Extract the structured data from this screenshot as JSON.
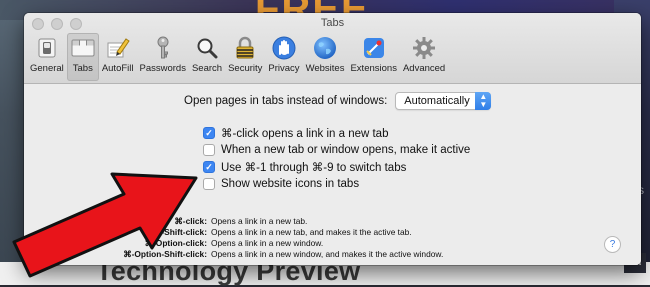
{
  "background": {
    "headline": "Technology Preview",
    "promo": "FREE",
    "corner_badge": "DII",
    "side_text": "ES"
  },
  "window": {
    "title": "Tabs"
  },
  "toolbar": {
    "items": [
      {
        "label": "General",
        "icon": "switch-icon"
      },
      {
        "label": "Tabs",
        "icon": "tabs-icon",
        "active": true
      },
      {
        "label": "AutoFill",
        "icon": "pencil-icon"
      },
      {
        "label": "Passwords",
        "icon": "key-icon"
      },
      {
        "label": "Search",
        "icon": "magnifier-icon"
      },
      {
        "label": "Security",
        "icon": "lock-icon"
      },
      {
        "label": "Privacy",
        "icon": "hand-icon"
      },
      {
        "label": "Websites",
        "icon": "globe-icon"
      },
      {
        "label": "Extensions",
        "icon": "puzzle-icon"
      },
      {
        "label": "Advanced",
        "icon": "gear-icon"
      }
    ]
  },
  "tabs_prefs": {
    "open_pages_label": "Open pages in tabs instead of windows:",
    "open_pages_value": "Automatically",
    "checkboxes": [
      {
        "label": "⌘-click opens a link in a new tab",
        "checked": true
      },
      {
        "label": "When a new tab or window opens, make it active",
        "checked": false
      },
      {
        "label": "Use ⌘-1 through ⌘-9 to switch tabs",
        "checked": true
      },
      {
        "label": "Show website icons in tabs",
        "checked": false
      }
    ],
    "shortcuts": [
      {
        "key": "⌘-click:",
        "desc": "Opens a link in a new tab."
      },
      {
        "key": "⌘-Shift-click:",
        "desc": "Opens a link in a new tab, and makes it the active tab."
      },
      {
        "key": "⌘-Option-click:",
        "desc": "Opens a link in a new window."
      },
      {
        "key": "⌘-Option-Shift-click:",
        "desc": "Opens a link in a new window, and makes it the active window."
      }
    ],
    "help_label": "?"
  },
  "colors": {
    "accent": "#3d86f2",
    "arrow": "#e8141a"
  }
}
